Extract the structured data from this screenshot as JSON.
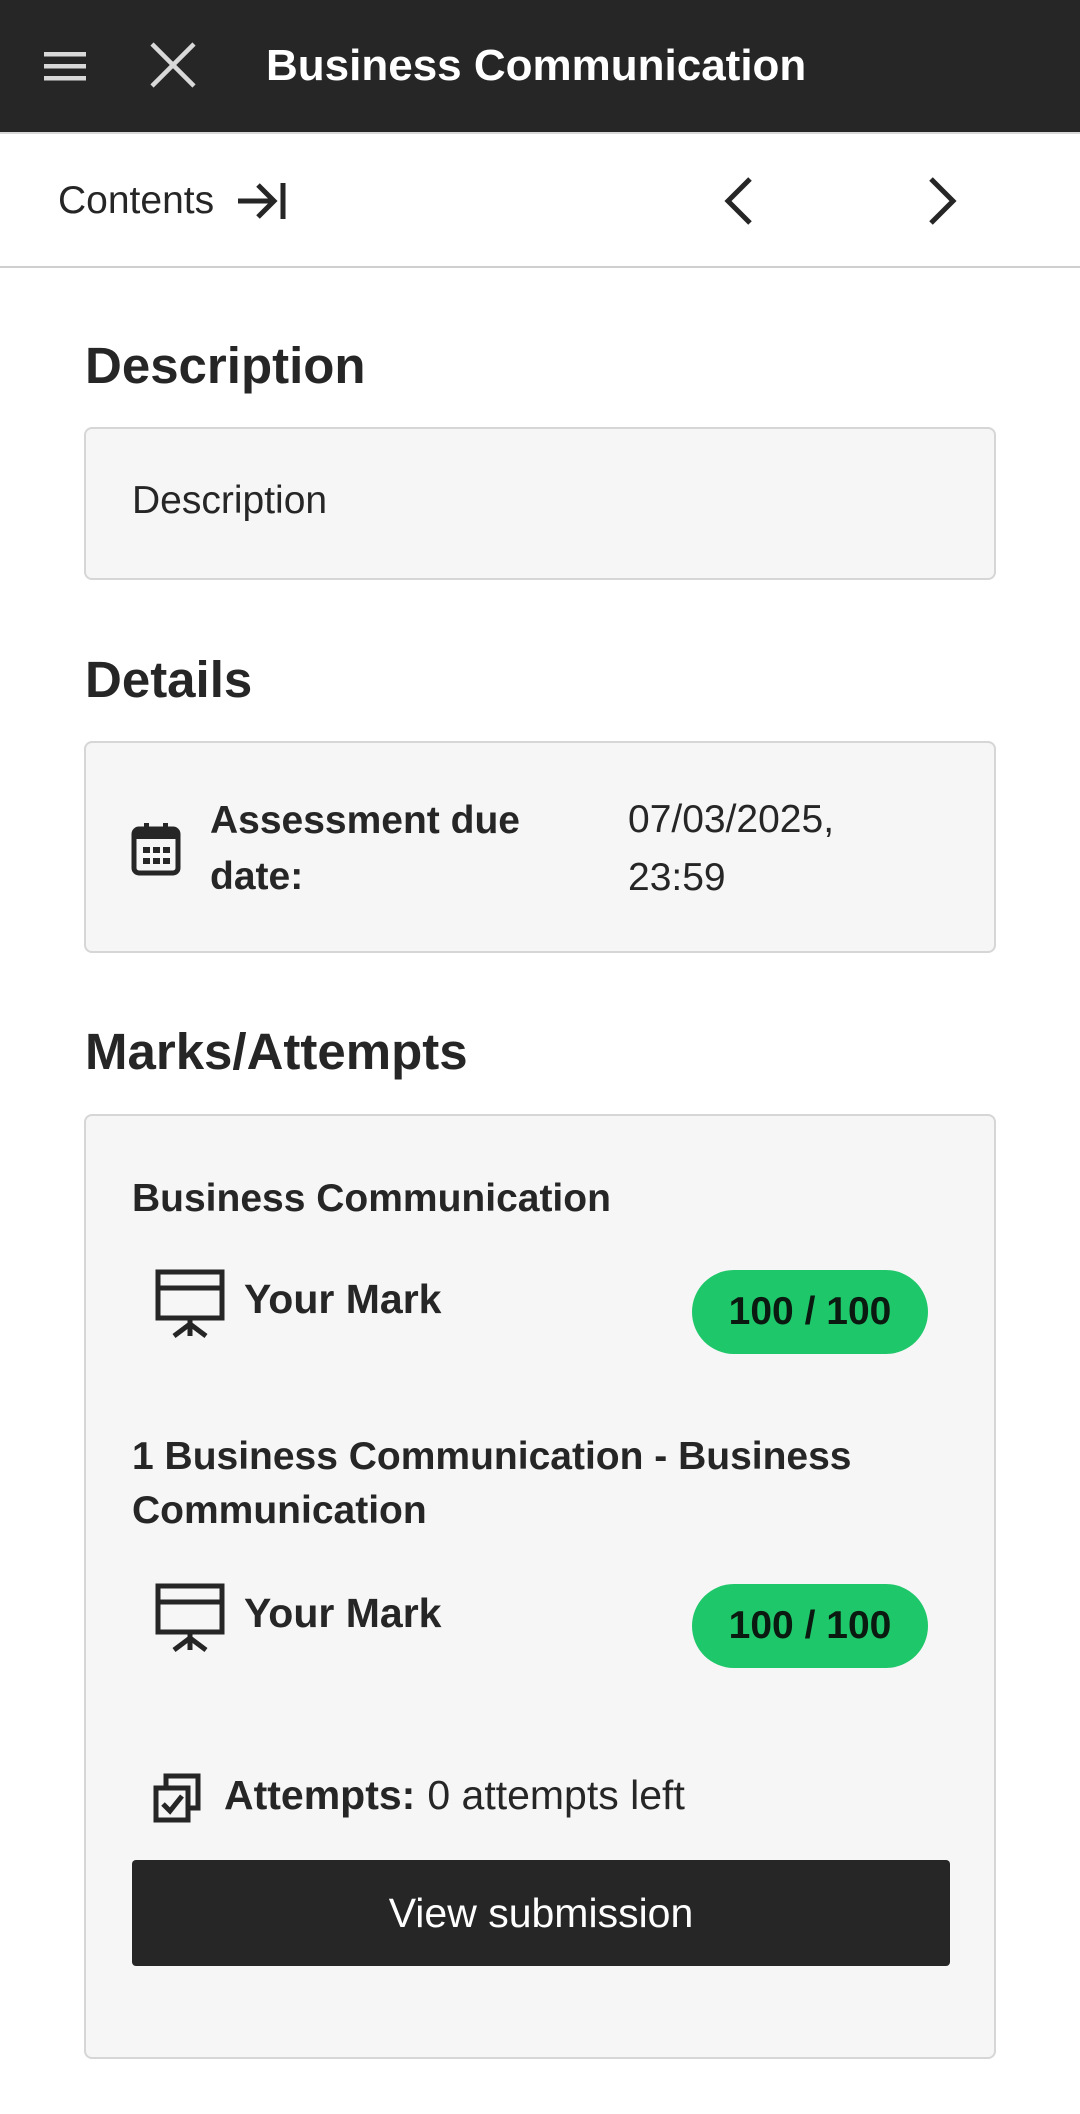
{
  "header": {
    "title": "Business Communication",
    "menu_icon": "hamburger-icon",
    "close_icon": "close-icon"
  },
  "subnav": {
    "contents_label": "Contents",
    "contents_icon": "arrow-to-right-bar-icon",
    "prev_icon": "chevron-left-icon",
    "next_icon": "chevron-right-icon"
  },
  "description": {
    "heading": "Description",
    "text": "Description"
  },
  "details": {
    "heading": "Details",
    "due_label": "Assessment due date:",
    "due_value": "07/03/2025, 23:59",
    "icon": "calendar-icon"
  },
  "marks": {
    "heading": "Marks/Attempts",
    "items": [
      {
        "title": "Business Communication",
        "label": "Your Mark",
        "score": "100 / 100",
        "icon": "presentation-board-icon"
      },
      {
        "title": "1 Business Communication - Business Communication",
        "label": "Your Mark",
        "score": "100 / 100",
        "icon": "presentation-board-icon"
      }
    ],
    "attempts_label": "Attempts:",
    "attempts_value": "0 attempts left",
    "attempts_icon": "stacked-checkbox-icon",
    "view_button": "View submission",
    "badge_color": "#1ec769"
  }
}
